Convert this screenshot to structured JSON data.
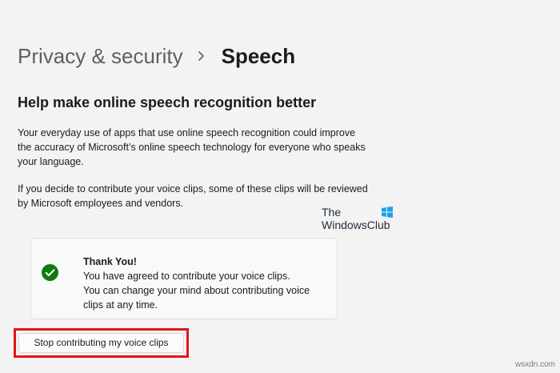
{
  "breadcrumb": {
    "parent": "Privacy & security",
    "current": "Speech"
  },
  "section": {
    "title": "Help make online speech recognition better",
    "paragraph_1": "Your everyday use of apps that use online speech recognition could improve the accuracy of Microsoft’s online speech technology for everyone who speaks your language.",
    "paragraph_2": "If you decide to contribute your voice clips, some of these clips will be reviewed by Microsoft employees and vendors."
  },
  "watermark": {
    "line1": "The",
    "line2": "WindowsClub",
    "logo_colors": [
      "#1aa3e8",
      "#1aa3e8",
      "#1aa3e8",
      "#1aa3e8"
    ]
  },
  "status_card": {
    "icon": "checkmark-circle-icon",
    "icon_color": "#0f7b0f",
    "title": "Thank You!",
    "line_1": "You have agreed to contribute your voice clips.",
    "line_2": "You can change your mind about contributing voice clips at any time."
  },
  "actions": {
    "stop_label": "Stop contributing my voice clips",
    "highlight_color": "#e3141b"
  },
  "site_mark": "wsxdn.com"
}
